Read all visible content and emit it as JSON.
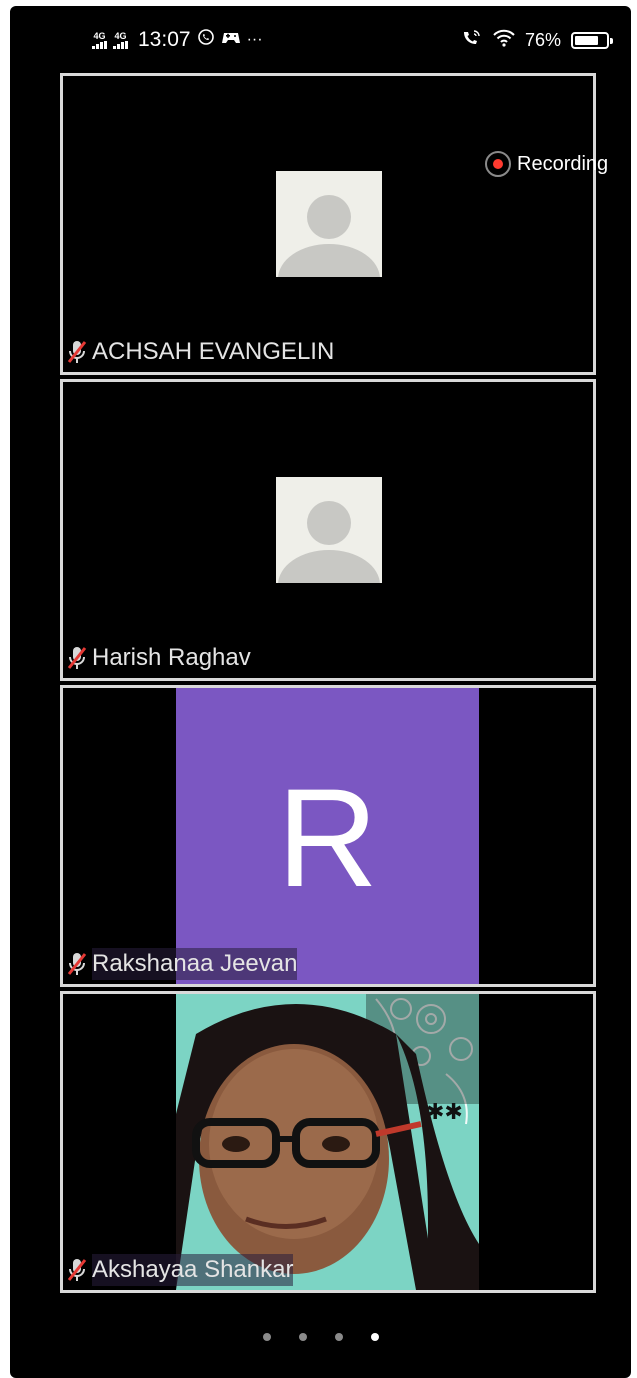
{
  "status_bar": {
    "network_1": "4G",
    "network_2": "4G",
    "time": "13:07",
    "notif_icons": [
      "whatsapp-icon",
      "game-icon",
      "more-dots-icon"
    ],
    "more": "···",
    "right_icons": [
      "wifi-calling-icon",
      "wifi-icon",
      "battery-icon"
    ],
    "battery_percent": "76%",
    "battery_level": 0.76
  },
  "recording": {
    "label": "Recording",
    "dot_color": "#ff3b30"
  },
  "participants": [
    {
      "name": "ACHSAH EVANGELIN",
      "muted": true,
      "video": "placeholder-avatar"
    },
    {
      "name": "Harish Raghav",
      "muted": true,
      "video": "placeholder-avatar"
    },
    {
      "name": "Rakshanaa Jeevan",
      "muted": true,
      "video": "initial",
      "initial": "R",
      "color": "#7b57c2"
    },
    {
      "name": "Akshayaa Shankar",
      "muted": true,
      "video": "camera"
    }
  ],
  "pagination": {
    "total": 4,
    "active": 4
  }
}
